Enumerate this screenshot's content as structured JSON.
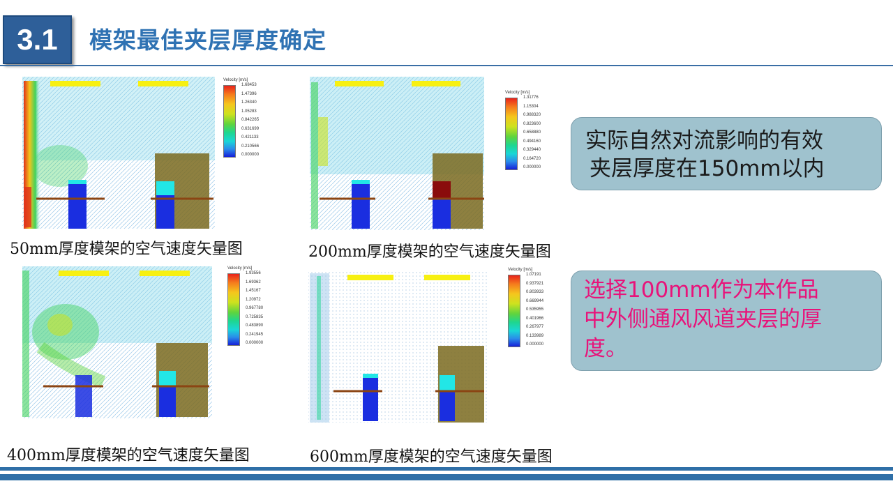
{
  "header": {
    "section_number": "3.1",
    "title": "模架最佳夹层厚度确定"
  },
  "figures": [
    {
      "caption": "50mm厚度模架的空气速度矢量图",
      "colorbar_title": "Velocity [m/s]",
      "colorbar_values": [
        "1.68453",
        "1.47396",
        "1.26340",
        "1.05283",
        "0.842265",
        "0.631699",
        "0.421133",
        "0.210566",
        "0.000000"
      ]
    },
    {
      "caption": "200mm厚度模架的空气速度矢量图",
      "colorbar_title": "Velocity [m/s]",
      "colorbar_values": [
        "1.31776",
        "1.15304",
        "0.988320",
        "0.823600",
        "0.658880",
        "0.494160",
        "0.329440",
        "0.164720",
        "0.000000"
      ]
    },
    {
      "caption": "400mm厚度模架的空气速度矢量图",
      "colorbar_title": "Velocity [m/s]",
      "colorbar_values": [
        "1.93556",
        "1.69362",
        "1.45167",
        "1.20972",
        "0.967780",
        "0.725835",
        "0.483890",
        "0.241945",
        "0.000000"
      ]
    },
    {
      "caption": "600mm厚度模架的空气速度矢量图",
      "colorbar_title": "Velocity [m/s]",
      "colorbar_values": [
        "1.07191",
        "0.937921",
        "0.803933",
        "0.669944",
        "0.535955",
        "0.401966",
        "0.267977",
        "0.133989",
        "0.000000"
      ]
    }
  ],
  "info_boxes": [
    {
      "lines": [
        "实际自然对流影响的有效",
        "夹层厚度在150mm以内"
      ],
      "text_color": "#1a1a1a"
    },
    {
      "lines": [
        "选择100mm作为本作品",
        "中外侧通风风道夹层的厚",
        "度。"
      ],
      "text_color": "#e8137a"
    }
  ],
  "colors": {
    "accent": "#2f72b3",
    "badge": "#2e5f99",
    "info_box_bg": "#9fc2ce",
    "highlight_text": "#e8137a"
  }
}
